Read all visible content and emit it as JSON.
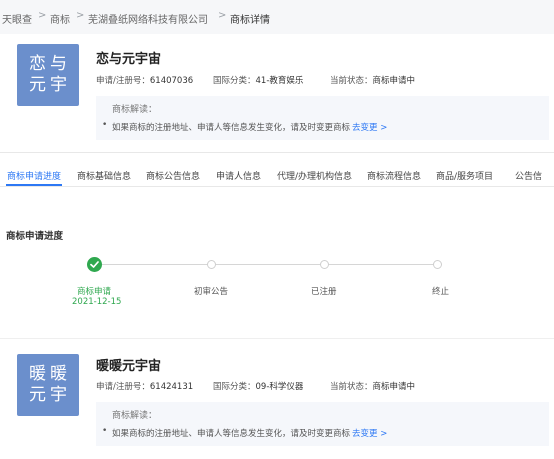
{
  "breadcrumb": {
    "items": [
      "天眼查",
      "商标",
      "芜湖叠纸网络科技有限公司",
      "商标详情"
    ],
    "separator": ">"
  },
  "trademark1": {
    "logo_chars": [
      "恋",
      "与",
      "元",
      "宇"
    ],
    "name": "恋与元宇宙",
    "reg_no_label": "申请/注册号：",
    "reg_no": "61407036",
    "class_label": "国际分类：",
    "class_value": "41-教育娱乐",
    "status_label": "当前状态：",
    "status_value": "商标申请中",
    "interp_title": "商标解读：",
    "interp_text": "如果商标的注册地址、申请人等信息发生变化，请及时变更商标",
    "interp_link": "去变更 >"
  },
  "tabs": [
    "商标申请进度",
    "商标基础信息",
    "商标公告信息",
    "申请人信息",
    "代理/办理机构信息",
    "商标流程信息",
    "商品/服务项目",
    "公告信"
  ],
  "active_tab": 0,
  "progress": {
    "section_title": "商标申请进度",
    "steps": [
      {
        "label": "商标申请",
        "date": "2021-12-15",
        "done": true
      },
      {
        "label": "初审公告",
        "date": "",
        "done": false
      },
      {
        "label": "已注册",
        "date": "",
        "done": false
      },
      {
        "label": "终止",
        "date": "",
        "done": false
      }
    ]
  },
  "trademark2": {
    "logo_chars": [
      "暖",
      "暖",
      "元",
      "宇"
    ],
    "name": "暖暖元宇宙",
    "reg_no_label": "申请/注册号：",
    "reg_no": "61424131",
    "class_label": "国际分类：",
    "class_value": "09-科学仪器",
    "status_label": "当前状态：",
    "status_value": "商标申请中",
    "interp_title": "商标解读：",
    "interp_text": "如果商标的注册地址、申请人等信息发生变化，请及时变更商标",
    "interp_link": "去变更 >"
  },
  "colors": {
    "accent": "#2d78f4",
    "success": "#2fa84f",
    "logo_bg": "#6b8fcc"
  },
  "icons": [
    "check-icon",
    "bullet-icon"
  ]
}
